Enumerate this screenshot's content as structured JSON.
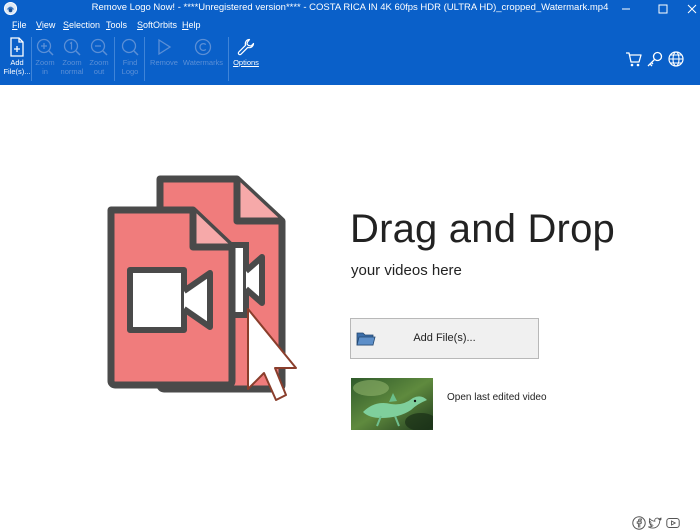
{
  "window": {
    "title": "Remove Logo Now! - ****Unregistered version**** - COSTA RICA IN 4K 60fps HDR (ULTRA HD)_cropped_Watermark.mp4"
  },
  "menu": [
    {
      "underline": "F",
      "rest": "ile"
    },
    {
      "underline": "V",
      "rest": "iew"
    },
    {
      "underline": "S",
      "rest": "election"
    },
    {
      "underline": "T",
      "rest": "ools"
    },
    {
      "underline": "S",
      "rest": "oftOrbits"
    },
    {
      "underline": "H",
      "rest": "elp"
    }
  ],
  "toolbar": {
    "add_files": "Add\nFile(s)...",
    "zoom_in": "Zoom\nin",
    "zoom_normal": "Zoom\nnormal",
    "zoom_out": "Zoom\nout",
    "find_logo": "Find\nLogo",
    "remove": "Remove",
    "watermarks": "Watermarks",
    "options": "Options"
  },
  "main": {
    "title": "Drag and Drop",
    "subtitle": "your videos here",
    "add_files_button": "Add File(s)...",
    "open_last": "Open last edited video"
  },
  "colors": {
    "chrome_blue": "#0a60c9",
    "file_pink": "#f07c7c",
    "file_outline": "#4a4a4a"
  }
}
